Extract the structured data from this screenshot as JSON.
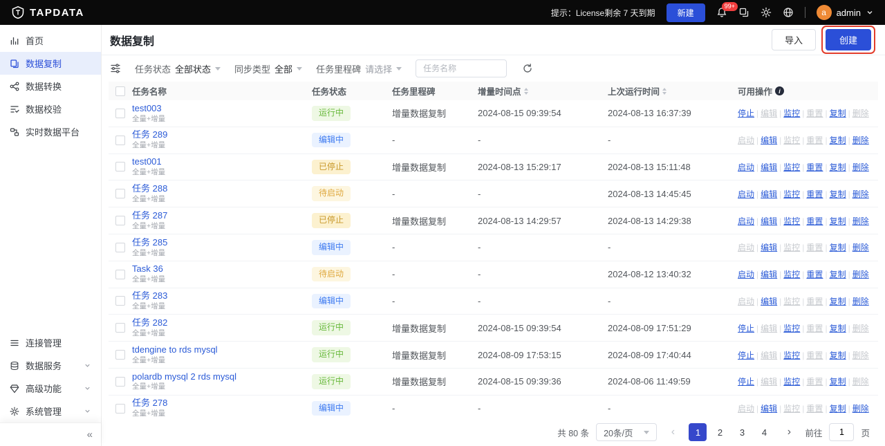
{
  "topbar": {
    "brand": "TAPDATA",
    "license_notice": "提示：License剩余 7 天到期",
    "new_button": "新建",
    "notification_badge": "99+",
    "avatar_letter": "a",
    "username": "admin"
  },
  "sidebar": {
    "items_top": [
      {
        "label": "首页"
      },
      {
        "label": "数据复制"
      },
      {
        "label": "数据转换"
      },
      {
        "label": "数据校验"
      },
      {
        "label": "实时数据平台"
      }
    ],
    "items_bottom": [
      {
        "label": "连接管理"
      },
      {
        "label": "数据服务"
      },
      {
        "label": "高级功能"
      },
      {
        "label": "系统管理"
      }
    ],
    "collapse_icon": "«"
  },
  "page": {
    "title": "数据复制",
    "import_button": "导入",
    "create_button": "创建"
  },
  "filters": {
    "task_status_label": "任务状态",
    "task_status_value": "全部状态",
    "sync_type_label": "同步类型",
    "sync_type_value": "全部",
    "milestone_label": "任务里程碑",
    "milestone_value": "请选择",
    "search_placeholder": "任务名称"
  },
  "table": {
    "columns": [
      "任务名称",
      "任务状态",
      "任务里程碑",
      "增量时间点",
      "上次运行时间",
      "可用操作"
    ],
    "action_separator": "|",
    "rows": [
      {
        "name": "test003",
        "sub": "全量+增量",
        "status": "运行中",
        "status_type": "running",
        "milestone": "增量数据复制",
        "inc_time": "2024-08-15 09:39:54",
        "last_run": "2024-08-13 16:37:39",
        "actions": [
          {
            "label": "停止",
            "name": "stop",
            "enabled": true
          },
          {
            "label": "编辑",
            "name": "edit",
            "enabled": false
          },
          {
            "label": "监控",
            "name": "monitor",
            "enabled": true
          },
          {
            "label": "重置",
            "name": "reset",
            "enabled": false
          },
          {
            "label": "复制",
            "name": "copy",
            "enabled": true
          },
          {
            "label": "删除",
            "name": "delete",
            "enabled": false
          }
        ]
      },
      {
        "name": "任务 289",
        "sub": "全量+增量",
        "status": "编辑中",
        "status_type": "editing",
        "milestone": "-",
        "inc_time": "-",
        "last_run": "-",
        "actions": [
          {
            "label": "启动",
            "name": "start",
            "enabled": false
          },
          {
            "label": "编辑",
            "name": "edit",
            "enabled": true
          },
          {
            "label": "监控",
            "name": "monitor",
            "enabled": false
          },
          {
            "label": "重置",
            "name": "reset",
            "enabled": false
          },
          {
            "label": "复制",
            "name": "copy",
            "enabled": true
          },
          {
            "label": "删除",
            "name": "delete",
            "enabled": true
          }
        ]
      },
      {
        "name": "test001",
        "sub": "全量+增量",
        "status": "已停止",
        "status_type": "stopped",
        "milestone": "增量数据复制",
        "inc_time": "2024-08-13 15:29:17",
        "last_run": "2024-08-13 15:11:48",
        "actions": [
          {
            "label": "启动",
            "name": "start",
            "enabled": true
          },
          {
            "label": "编辑",
            "name": "edit",
            "enabled": true
          },
          {
            "label": "监控",
            "name": "monitor",
            "enabled": true
          },
          {
            "label": "重置",
            "name": "reset",
            "enabled": true
          },
          {
            "label": "复制",
            "name": "copy",
            "enabled": true
          },
          {
            "label": "删除",
            "name": "delete",
            "enabled": true
          }
        ]
      },
      {
        "name": "任务 288",
        "sub": "全量+增量",
        "status": "待启动",
        "status_type": "pending",
        "milestone": "-",
        "inc_time": "-",
        "last_run": "2024-08-13 14:45:45",
        "actions": [
          {
            "label": "启动",
            "name": "start",
            "enabled": true
          },
          {
            "label": "编辑",
            "name": "edit",
            "enabled": true
          },
          {
            "label": "监控",
            "name": "monitor",
            "enabled": true
          },
          {
            "label": "重置",
            "name": "reset",
            "enabled": true
          },
          {
            "label": "复制",
            "name": "copy",
            "enabled": true
          },
          {
            "label": "删除",
            "name": "delete",
            "enabled": true
          }
        ]
      },
      {
        "name": "任务 287",
        "sub": "全量+增量",
        "status": "已停止",
        "status_type": "stopped",
        "milestone": "增量数据复制",
        "inc_time": "2024-08-13 14:29:57",
        "last_run": "2024-08-13 14:29:38",
        "actions": [
          {
            "label": "启动",
            "name": "start",
            "enabled": true
          },
          {
            "label": "编辑",
            "name": "edit",
            "enabled": true
          },
          {
            "label": "监控",
            "name": "monitor",
            "enabled": true
          },
          {
            "label": "重置",
            "name": "reset",
            "enabled": true
          },
          {
            "label": "复制",
            "name": "copy",
            "enabled": true
          },
          {
            "label": "删除",
            "name": "delete",
            "enabled": true
          }
        ]
      },
      {
        "name": "任务 285",
        "sub": "全量+增量",
        "status": "编辑中",
        "status_type": "editing",
        "milestone": "-",
        "inc_time": "-",
        "last_run": "-",
        "actions": [
          {
            "label": "启动",
            "name": "start",
            "enabled": false
          },
          {
            "label": "编辑",
            "name": "edit",
            "enabled": true
          },
          {
            "label": "监控",
            "name": "monitor",
            "enabled": false
          },
          {
            "label": "重置",
            "name": "reset",
            "enabled": false
          },
          {
            "label": "复制",
            "name": "copy",
            "enabled": true
          },
          {
            "label": "删除",
            "name": "delete",
            "enabled": true
          }
        ]
      },
      {
        "name": "Task 36",
        "sub": "全量+增量",
        "status": "待启动",
        "status_type": "pending",
        "milestone": "-",
        "inc_time": "-",
        "last_run": "2024-08-12 13:40:32",
        "actions": [
          {
            "label": "启动",
            "name": "start",
            "enabled": true
          },
          {
            "label": "编辑",
            "name": "edit",
            "enabled": true
          },
          {
            "label": "监控",
            "name": "monitor",
            "enabled": true
          },
          {
            "label": "重置",
            "name": "reset",
            "enabled": true
          },
          {
            "label": "复制",
            "name": "copy",
            "enabled": true
          },
          {
            "label": "删除",
            "name": "delete",
            "enabled": true
          }
        ]
      },
      {
        "name": "任务 283",
        "sub": "全量+增量",
        "status": "编辑中",
        "status_type": "editing",
        "milestone": "-",
        "inc_time": "-",
        "last_run": "-",
        "actions": [
          {
            "label": "启动",
            "name": "start",
            "enabled": false
          },
          {
            "label": "编辑",
            "name": "edit",
            "enabled": true
          },
          {
            "label": "监控",
            "name": "monitor",
            "enabled": false
          },
          {
            "label": "重置",
            "name": "reset",
            "enabled": false
          },
          {
            "label": "复制",
            "name": "copy",
            "enabled": true
          },
          {
            "label": "删除",
            "name": "delete",
            "enabled": true
          }
        ]
      },
      {
        "name": "任务 282",
        "sub": "全量+增量",
        "status": "运行中",
        "status_type": "running",
        "milestone": "增量数据复制",
        "inc_time": "2024-08-15 09:39:54",
        "last_run": "2024-08-09 17:51:29",
        "actions": [
          {
            "label": "停止",
            "name": "stop",
            "enabled": true
          },
          {
            "label": "编辑",
            "name": "edit",
            "enabled": false
          },
          {
            "label": "监控",
            "name": "monitor",
            "enabled": true
          },
          {
            "label": "重置",
            "name": "reset",
            "enabled": false
          },
          {
            "label": "复制",
            "name": "copy",
            "enabled": true
          },
          {
            "label": "删除",
            "name": "delete",
            "enabled": false
          }
        ]
      },
      {
        "name": "tdengine to rds mysql",
        "sub": "全量+增量",
        "status": "运行中",
        "status_type": "running",
        "milestone": "增量数据复制",
        "inc_time": "2024-08-09 17:53:15",
        "last_run": "2024-08-09 17:40:44",
        "actions": [
          {
            "label": "停止",
            "name": "stop",
            "enabled": true
          },
          {
            "label": "编辑",
            "name": "edit",
            "enabled": false
          },
          {
            "label": "监控",
            "name": "monitor",
            "enabled": true
          },
          {
            "label": "重置",
            "name": "reset",
            "enabled": false
          },
          {
            "label": "复制",
            "name": "copy",
            "enabled": true
          },
          {
            "label": "删除",
            "name": "delete",
            "enabled": false
          }
        ]
      },
      {
        "name": "polardb mysql 2 rds mysql",
        "sub": "全量+增量",
        "status": "运行中",
        "status_type": "running",
        "milestone": "增量数据复制",
        "inc_time": "2024-08-15 09:39:36",
        "last_run": "2024-08-06 11:49:59",
        "actions": [
          {
            "label": "停止",
            "name": "stop",
            "enabled": true
          },
          {
            "label": "编辑",
            "name": "edit",
            "enabled": false
          },
          {
            "label": "监控",
            "name": "monitor",
            "enabled": true
          },
          {
            "label": "重置",
            "name": "reset",
            "enabled": false
          },
          {
            "label": "复制",
            "name": "copy",
            "enabled": true
          },
          {
            "label": "删除",
            "name": "delete",
            "enabled": false
          }
        ]
      },
      {
        "name": "任务 278",
        "sub": "全量+增量",
        "status": "编辑中",
        "status_type": "editing",
        "milestone": "-",
        "inc_time": "-",
        "last_run": "-",
        "actions": [
          {
            "label": "启动",
            "name": "start",
            "enabled": false
          },
          {
            "label": "编辑",
            "name": "edit",
            "enabled": true
          },
          {
            "label": "监控",
            "name": "monitor",
            "enabled": false
          },
          {
            "label": "重置",
            "name": "reset",
            "enabled": false
          },
          {
            "label": "复制",
            "name": "copy",
            "enabled": true
          },
          {
            "label": "删除",
            "name": "delete",
            "enabled": true
          }
        ]
      }
    ]
  },
  "pagination": {
    "total": "共 80 条",
    "page_size": "20条/页",
    "prev_icon": "‹",
    "next_icon": "›",
    "pages": [
      "1",
      "2",
      "3",
      "4"
    ],
    "active_page": "1",
    "goto_label": "前往",
    "goto_value": "1",
    "goto_suffix": "页"
  },
  "colors": {
    "brand_blue": "#2b4fd8",
    "annotation_red": "#e23c2b",
    "status_running": "#67b83a",
    "status_editing": "#3f7bf0",
    "status_stopped": "#c9992b",
    "status_pending": "#dfa940"
  }
}
